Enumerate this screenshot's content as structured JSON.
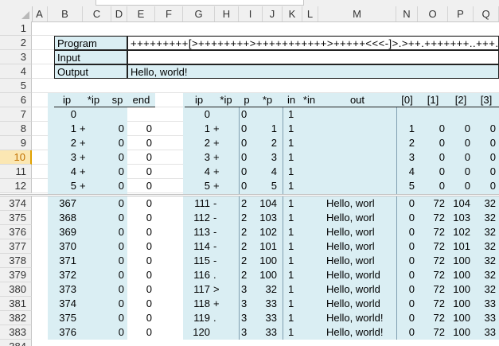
{
  "columns": [
    "A",
    "B",
    "C",
    "D",
    "E",
    "F",
    "G",
    "H",
    "I",
    "J",
    "K",
    "L",
    "M",
    "N",
    "O",
    "P",
    "Q"
  ],
  "labels": {
    "program": "Program",
    "input": "Input",
    "output": "Output"
  },
  "program_value": "+++++++++[>++++++++>+++++++++++>+++++<<<-]>.>++.+++++++..+++.>-.",
  "input_value": "",
  "output_value": "Hello, world!",
  "table_headers": {
    "left": [
      "ip",
      "*ip",
      "sp",
      "end"
    ],
    "right": [
      "ip",
      "*ip",
      "p",
      "*p",
      "in",
      "*in",
      "out",
      "[0]",
      "[1]",
      "[2]",
      "[3]"
    ]
  },
  "selected_row": "10",
  "top_rows": [
    {
      "row": "1"
    },
    {
      "row": "2"
    },
    {
      "row": "3"
    },
    {
      "row": "4"
    },
    {
      "row": "5"
    },
    {
      "row": "6"
    },
    {
      "row": "7",
      "ip": "0",
      "ipc": "",
      "sp": "",
      "end": "",
      "ip2": "0",
      "ip2c": "",
      "p": "0",
      "pv": "",
      "in": "1",
      "inc": "",
      "out": "",
      "m0": "",
      "m1": "",
      "m2": "",
      "m3": ""
    },
    {
      "row": "8",
      "ip": "1",
      "ipc": "+",
      "sp": "0",
      "end": "0",
      "ip2": "1",
      "ip2c": "+",
      "p": "0",
      "pv": "1",
      "in": "1",
      "inc": "",
      "out": "",
      "m0": "1",
      "m1": "0",
      "m2": "0",
      "m3": "0"
    },
    {
      "row": "9",
      "ip": "2",
      "ipc": "+",
      "sp": "0",
      "end": "0",
      "ip2": "2",
      "ip2c": "+",
      "p": "0",
      "pv": "2",
      "in": "1",
      "inc": "",
      "out": "",
      "m0": "2",
      "m1": "0",
      "m2": "0",
      "m3": "0"
    },
    {
      "row": "10",
      "ip": "3",
      "ipc": "+",
      "sp": "0",
      "end": "0",
      "ip2": "3",
      "ip2c": "+",
      "p": "0",
      "pv": "3",
      "in": "1",
      "inc": "",
      "out": "",
      "m0": "3",
      "m1": "0",
      "m2": "0",
      "m3": "0"
    },
    {
      "row": "11",
      "ip": "4",
      "ipc": "+",
      "sp": "0",
      "end": "0",
      "ip2": "4",
      "ip2c": "+",
      "p": "0",
      "pv": "4",
      "in": "1",
      "inc": "",
      "out": "",
      "m0": "4",
      "m1": "0",
      "m2": "0",
      "m3": "0"
    },
    {
      "row": "12",
      "ip": "5",
      "ipc": "+",
      "sp": "0",
      "end": "0",
      "ip2": "5",
      "ip2c": "+",
      "p": "0",
      "pv": "5",
      "in": "1",
      "inc": "",
      "out": "",
      "m0": "5",
      "m1": "0",
      "m2": "0",
      "m3": "0"
    }
  ],
  "bottom_rows": [
    {
      "row": "374",
      "ip": "367",
      "sp": "0",
      "end": "0",
      "ip2": "111",
      "ip2c": "-",
      "p": "2",
      "pv": "104",
      "in": "1",
      "out": "Hello, worl",
      "m0": "0",
      "m1": "72",
      "m2": "104",
      "m3": "32"
    },
    {
      "row": "375",
      "ip": "368",
      "sp": "0",
      "end": "0",
      "ip2": "112",
      "ip2c": "-",
      "p": "2",
      "pv": "103",
      "in": "1",
      "out": "Hello, worl",
      "m0": "0",
      "m1": "72",
      "m2": "103",
      "m3": "32"
    },
    {
      "row": "376",
      "ip": "369",
      "sp": "0",
      "end": "0",
      "ip2": "113",
      "ip2c": "-",
      "p": "2",
      "pv": "102",
      "in": "1",
      "out": "Hello, worl",
      "m0": "0",
      "m1": "72",
      "m2": "102",
      "m3": "32"
    },
    {
      "row": "377",
      "ip": "370",
      "sp": "0",
      "end": "0",
      "ip2": "114",
      "ip2c": "-",
      "p": "2",
      "pv": "101",
      "in": "1",
      "out": "Hello, worl",
      "m0": "0",
      "m1": "72",
      "m2": "101",
      "m3": "32"
    },
    {
      "row": "378",
      "ip": "371",
      "sp": "0",
      "end": "0",
      "ip2": "115",
      "ip2c": "-",
      "p": "2",
      "pv": "100",
      "in": "1",
      "out": "Hello, worl",
      "m0": "0",
      "m1": "72",
      "m2": "100",
      "m3": "32"
    },
    {
      "row": "379",
      "ip": "372",
      "sp": "0",
      "end": "0",
      "ip2": "116",
      "ip2c": ".",
      "p": "2",
      "pv": "100",
      "in": "1",
      "out": "Hello, world",
      "m0": "0",
      "m1": "72",
      "m2": "100",
      "m3": "32"
    },
    {
      "row": "380",
      "ip": "373",
      "sp": "0",
      "end": "0",
      "ip2": "117",
      "ip2c": ">",
      "p": "3",
      "pv": "32",
      "in": "1",
      "out": "Hello, world",
      "m0": "0",
      "m1": "72",
      "m2": "100",
      "m3": "32"
    },
    {
      "row": "381",
      "ip": "374",
      "sp": "0",
      "end": "0",
      "ip2": "118",
      "ip2c": "+",
      "p": "3",
      "pv": "33",
      "in": "1",
      "out": "Hello, world",
      "m0": "0",
      "m1": "72",
      "m2": "100",
      "m3": "33"
    },
    {
      "row": "382",
      "ip": "375",
      "sp": "0",
      "end": "0",
      "ip2": "119",
      "ip2c": ".",
      "p": "3",
      "pv": "33",
      "in": "1",
      "out": "Hello, world!",
      "m0": "0",
      "m1": "72",
      "m2": "100",
      "m3": "33"
    },
    {
      "row": "383",
      "ip": "376",
      "sp": "0",
      "end": "0",
      "ip2": "120",
      "ip2c": "",
      "p": "3",
      "pv": "33",
      "in": "1",
      "out": "Hello, world!",
      "m0": "0",
      "m1": "72",
      "m2": "100",
      "m3": "33"
    },
    {
      "row": "384"
    }
  ],
  "colors": {
    "cell_fill": "#daeef3",
    "header_fill": "#f0f0f0",
    "selected_header": "#fbe7b3",
    "grid": "#d9d9d9"
  }
}
